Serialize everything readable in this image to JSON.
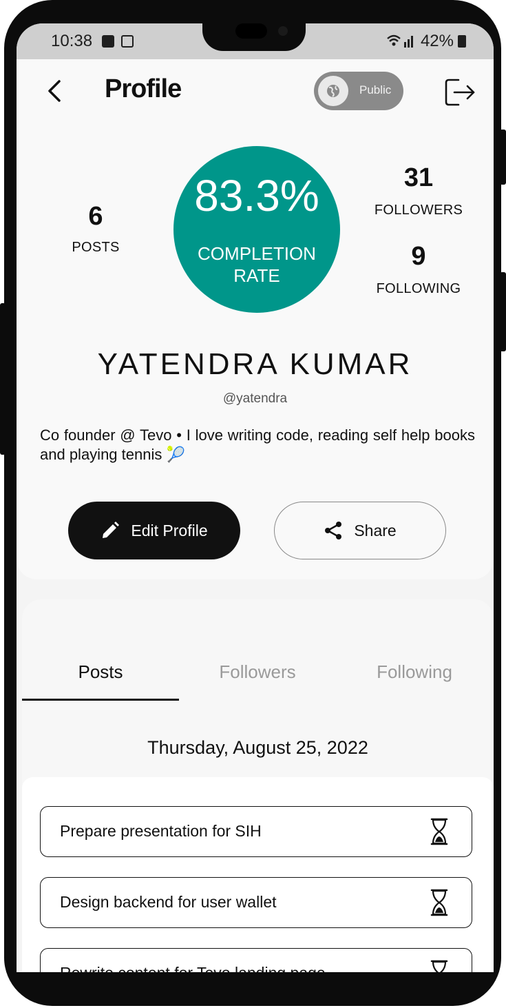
{
  "status_bar": {
    "time": "10:38",
    "battery": "42%"
  },
  "header": {
    "title": "Profile",
    "visibility_label": "Public"
  },
  "stats": {
    "posts_count": "6",
    "posts_label": "POSTS",
    "completion_value": "83.3%",
    "completion_label_line1": "COMPLETION",
    "completion_label_line2": "RATE",
    "followers_count": "31",
    "followers_label": "FOLLOWERS",
    "following_count": "9",
    "following_label": "FOLLOWING"
  },
  "profile": {
    "name": "YATENDRA KUMAR",
    "handle": "@yatendra",
    "bio": "Co founder @ Tevo • I love writing code, reading self help books and playing tennis 🎾"
  },
  "actions": {
    "edit_label": "Edit Profile",
    "share_label": "Share"
  },
  "tabs": [
    {
      "label": "Posts",
      "active": true
    },
    {
      "label": "Followers",
      "active": false
    },
    {
      "label": "Following",
      "active": false
    }
  ],
  "feed": {
    "date": "Thursday, August 25, 2022",
    "tasks": [
      {
        "title": "Prepare presentation for SIH",
        "icon": "hourglass-icon"
      },
      {
        "title": "Design backend for user wallet",
        "icon": "hourglass-icon"
      },
      {
        "title": "Rewrite content for Tevo landing page",
        "icon": "hourglass-icon"
      }
    ]
  },
  "colors": {
    "accent": "#00968a",
    "primary_button": "#111111",
    "toggle_bg": "#8a8a8a"
  }
}
